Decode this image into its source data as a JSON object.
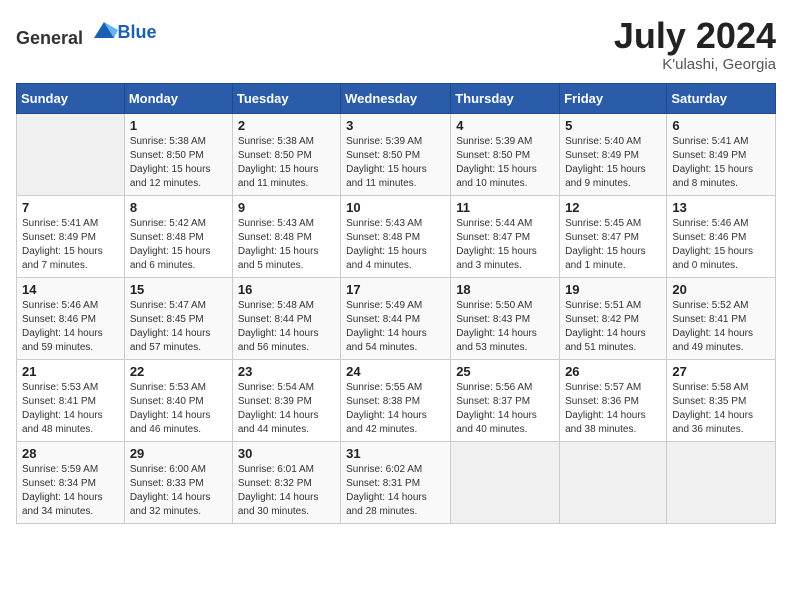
{
  "header": {
    "logo_general": "General",
    "logo_blue": "Blue",
    "month_year": "July 2024",
    "location": "K'ulashi, Georgia"
  },
  "weekdays": [
    "Sunday",
    "Monday",
    "Tuesday",
    "Wednesday",
    "Thursday",
    "Friday",
    "Saturday"
  ],
  "weeks": [
    [
      {
        "day": "",
        "info": ""
      },
      {
        "day": "1",
        "info": "Sunrise: 5:38 AM\nSunset: 8:50 PM\nDaylight: 15 hours\nand 12 minutes."
      },
      {
        "day": "2",
        "info": "Sunrise: 5:38 AM\nSunset: 8:50 PM\nDaylight: 15 hours\nand 11 minutes."
      },
      {
        "day": "3",
        "info": "Sunrise: 5:39 AM\nSunset: 8:50 PM\nDaylight: 15 hours\nand 11 minutes."
      },
      {
        "day": "4",
        "info": "Sunrise: 5:39 AM\nSunset: 8:50 PM\nDaylight: 15 hours\nand 10 minutes."
      },
      {
        "day": "5",
        "info": "Sunrise: 5:40 AM\nSunset: 8:49 PM\nDaylight: 15 hours\nand 9 minutes."
      },
      {
        "day": "6",
        "info": "Sunrise: 5:41 AM\nSunset: 8:49 PM\nDaylight: 15 hours\nand 8 minutes."
      }
    ],
    [
      {
        "day": "7",
        "info": "Sunrise: 5:41 AM\nSunset: 8:49 PM\nDaylight: 15 hours\nand 7 minutes."
      },
      {
        "day": "8",
        "info": "Sunrise: 5:42 AM\nSunset: 8:48 PM\nDaylight: 15 hours\nand 6 minutes."
      },
      {
        "day": "9",
        "info": "Sunrise: 5:43 AM\nSunset: 8:48 PM\nDaylight: 15 hours\nand 5 minutes."
      },
      {
        "day": "10",
        "info": "Sunrise: 5:43 AM\nSunset: 8:48 PM\nDaylight: 15 hours\nand 4 minutes."
      },
      {
        "day": "11",
        "info": "Sunrise: 5:44 AM\nSunset: 8:47 PM\nDaylight: 15 hours\nand 3 minutes."
      },
      {
        "day": "12",
        "info": "Sunrise: 5:45 AM\nSunset: 8:47 PM\nDaylight: 15 hours\nand 1 minute."
      },
      {
        "day": "13",
        "info": "Sunrise: 5:46 AM\nSunset: 8:46 PM\nDaylight: 15 hours\nand 0 minutes."
      }
    ],
    [
      {
        "day": "14",
        "info": "Sunrise: 5:46 AM\nSunset: 8:46 PM\nDaylight: 14 hours\nand 59 minutes."
      },
      {
        "day": "15",
        "info": "Sunrise: 5:47 AM\nSunset: 8:45 PM\nDaylight: 14 hours\nand 57 minutes."
      },
      {
        "day": "16",
        "info": "Sunrise: 5:48 AM\nSunset: 8:44 PM\nDaylight: 14 hours\nand 56 minutes."
      },
      {
        "day": "17",
        "info": "Sunrise: 5:49 AM\nSunset: 8:44 PM\nDaylight: 14 hours\nand 54 minutes."
      },
      {
        "day": "18",
        "info": "Sunrise: 5:50 AM\nSunset: 8:43 PM\nDaylight: 14 hours\nand 53 minutes."
      },
      {
        "day": "19",
        "info": "Sunrise: 5:51 AM\nSunset: 8:42 PM\nDaylight: 14 hours\nand 51 minutes."
      },
      {
        "day": "20",
        "info": "Sunrise: 5:52 AM\nSunset: 8:41 PM\nDaylight: 14 hours\nand 49 minutes."
      }
    ],
    [
      {
        "day": "21",
        "info": "Sunrise: 5:53 AM\nSunset: 8:41 PM\nDaylight: 14 hours\nand 48 minutes."
      },
      {
        "day": "22",
        "info": "Sunrise: 5:53 AM\nSunset: 8:40 PM\nDaylight: 14 hours\nand 46 minutes."
      },
      {
        "day": "23",
        "info": "Sunrise: 5:54 AM\nSunset: 8:39 PM\nDaylight: 14 hours\nand 44 minutes."
      },
      {
        "day": "24",
        "info": "Sunrise: 5:55 AM\nSunset: 8:38 PM\nDaylight: 14 hours\nand 42 minutes."
      },
      {
        "day": "25",
        "info": "Sunrise: 5:56 AM\nSunset: 8:37 PM\nDaylight: 14 hours\nand 40 minutes."
      },
      {
        "day": "26",
        "info": "Sunrise: 5:57 AM\nSunset: 8:36 PM\nDaylight: 14 hours\nand 38 minutes."
      },
      {
        "day": "27",
        "info": "Sunrise: 5:58 AM\nSunset: 8:35 PM\nDaylight: 14 hours\nand 36 minutes."
      }
    ],
    [
      {
        "day": "28",
        "info": "Sunrise: 5:59 AM\nSunset: 8:34 PM\nDaylight: 14 hours\nand 34 minutes."
      },
      {
        "day": "29",
        "info": "Sunrise: 6:00 AM\nSunset: 8:33 PM\nDaylight: 14 hours\nand 32 minutes."
      },
      {
        "day": "30",
        "info": "Sunrise: 6:01 AM\nSunset: 8:32 PM\nDaylight: 14 hours\nand 30 minutes."
      },
      {
        "day": "31",
        "info": "Sunrise: 6:02 AM\nSunset: 8:31 PM\nDaylight: 14 hours\nand 28 minutes."
      },
      {
        "day": "",
        "info": ""
      },
      {
        "day": "",
        "info": ""
      },
      {
        "day": "",
        "info": ""
      }
    ]
  ]
}
